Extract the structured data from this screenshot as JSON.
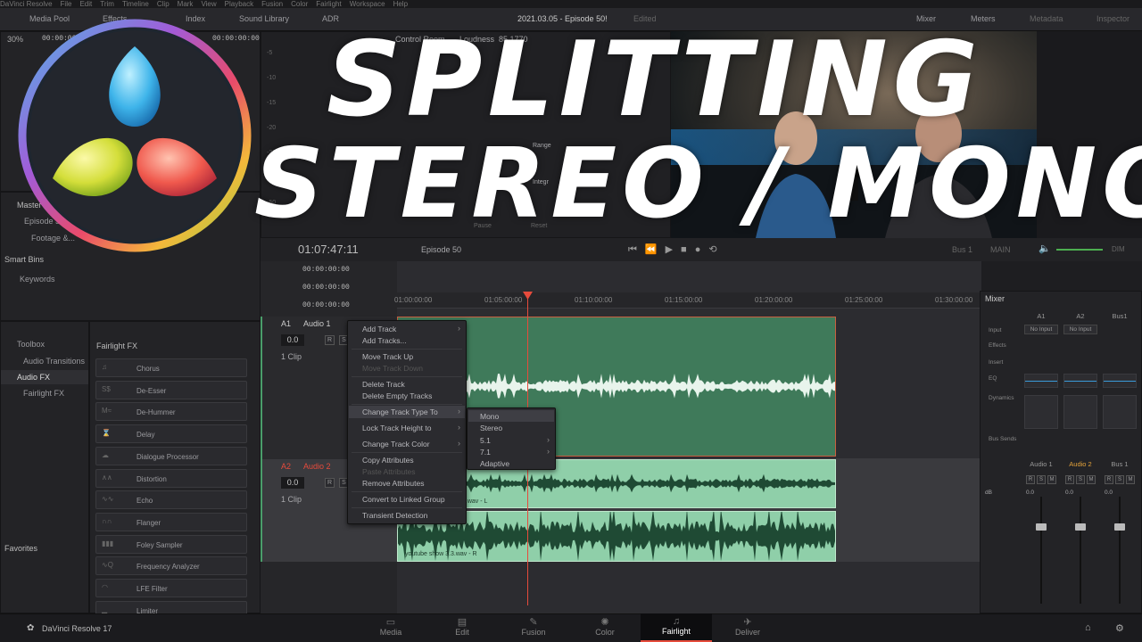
{
  "menubar": [
    "DaVinci Resolve",
    "File",
    "Edit",
    "Trim",
    "Timeline",
    "Clip",
    "Mark",
    "View",
    "Playback",
    "Fusion",
    "Color",
    "Fairlight",
    "Workspace",
    "Help"
  ],
  "toolbar": {
    "media_pool": "Media Pool",
    "effects": "Effects",
    "index": "Index",
    "sound_library": "Sound Library",
    "adr": "ADR",
    "project_title": "2021.03.05 - Episode 50!",
    "edited": "Edited",
    "mixer": "Mixer",
    "meters": "Meters",
    "metadata": "Metadata",
    "inspector": "Inspector"
  },
  "viewer": {
    "zoom": "30%",
    "tc_left": "00:00:00",
    "tc_right": "00:00:00:00",
    "control_room": "Control Room",
    "loudness": "Loudness",
    "loud_val": "85.1770",
    "range": "Range",
    "integr": "Integr",
    "pause": "Pause",
    "reset": "Reset"
  },
  "meter_ticks": [
    "-5",
    "-10",
    "-15",
    "-20",
    "-30",
    "-40",
    "-50"
  ],
  "media": {
    "master": "Master",
    "episode": "Episode 50",
    "footage": "Footage &...",
    "smart_bins": "Smart Bins",
    "keywords": "Keywords"
  },
  "fx_tree": {
    "toolbox": "Toolbox",
    "audio_transitions": "Audio Transitions",
    "audio_fx": "Audio FX",
    "fairlight_fx": "Fairlight FX",
    "favorites": "Favorites"
  },
  "fx_panel": {
    "title": "Fairlight FX",
    "items": [
      "Chorus",
      "De-Esser",
      "De-Hummer",
      "Delay",
      "Dialogue Processor",
      "Distortion",
      "Echo",
      "Flanger",
      "Foley Sampler",
      "Frequency Analyzer",
      "LFE Filter",
      "Limiter"
    ],
    "icons": [
      "chorus-icon",
      "de-esser-icon",
      "de-hummer-icon",
      "delay-icon",
      "dialogue-processor-icon",
      "distortion-icon",
      "echo-icon",
      "flanger-icon",
      "foley-sampler-icon",
      "frequency-analyzer-icon",
      "lfe-filter-icon",
      "limiter-icon"
    ],
    "icon_glyphs": [
      "♫",
      "S$",
      "M≈",
      "⌛",
      "☁",
      "∧∧",
      "∿∿",
      "∩∩",
      "▮▮▮",
      "∿Q",
      "◠",
      "▁"
    ]
  },
  "timeline": {
    "timecode": "01:07:47:11",
    "name": "Episode 50",
    "tc_rows": [
      "00:00:00:00",
      "00:00:00:00",
      "00:00:00:00"
    ],
    "ruler": [
      "01:00:00:00",
      "01:05:00:00",
      "01:10:00:00",
      "01:15:00:00",
      "01:20:00:00",
      "01:25:00:00",
      "01:30:00:00"
    ],
    "bus": "Bus 1",
    "main": "MAIN",
    "dim_label": "DIM"
  },
  "tracks": [
    {
      "id": "A1",
      "name": "Audio 1",
      "vol": "0.0",
      "r": "R",
      "s": "S",
      "clips": "1 Clip"
    },
    {
      "id": "A2",
      "name": "Audio 2",
      "vol": "0.0",
      "r": "R",
      "s": "S",
      "clips": "1 Clip",
      "clip_l": "3.wav - L",
      "clip_r": "youtube show 3.3.wav - R"
    }
  ],
  "context_menu": {
    "items": [
      "Add Track",
      "Add Tracks...",
      "Move Track Up",
      "Move Track Down",
      "Delete Track",
      "Delete Empty Tracks",
      "Change Track Type To",
      "Lock Track Height to",
      "Change Track Color",
      "Copy Attributes",
      "Paste Attributes",
      "Remove Attributes",
      "Convert to Linked Group",
      "Transient Detection"
    ]
  },
  "submenu": {
    "items": [
      "Mono",
      "Stereo",
      "5.1",
      "7.1",
      "Adaptive"
    ]
  },
  "mixer": {
    "title": "Mixer",
    "cols": [
      "A1",
      "A2",
      "Bus1"
    ],
    "no_input": "No Input",
    "rows": [
      "Input",
      "Effects",
      "Insert",
      "EQ",
      "Dynamics",
      "Bus Sends"
    ],
    "strips": [
      "Audio 1",
      "Audio 2",
      "Bus 1"
    ],
    "db": "dB",
    "vals": [
      "0.0",
      "0.0",
      "0.0"
    ],
    "btns": [
      "R",
      "S",
      "M"
    ]
  },
  "pages": [
    "Media",
    "Edit",
    "Fusion",
    "Color",
    "Fairlight",
    "Deliver"
  ],
  "app": {
    "name": "DaVinci Resolve 17"
  },
  "overlay": {
    "line1": "SPLITTING",
    "line2": "STEREO / MONO"
  },
  "colors": {
    "accent_red": "#e64b3c",
    "accent_orange": "#e3a23a",
    "clip_green": "#3f7a5a",
    "clip_light": "#8fcfa9"
  }
}
